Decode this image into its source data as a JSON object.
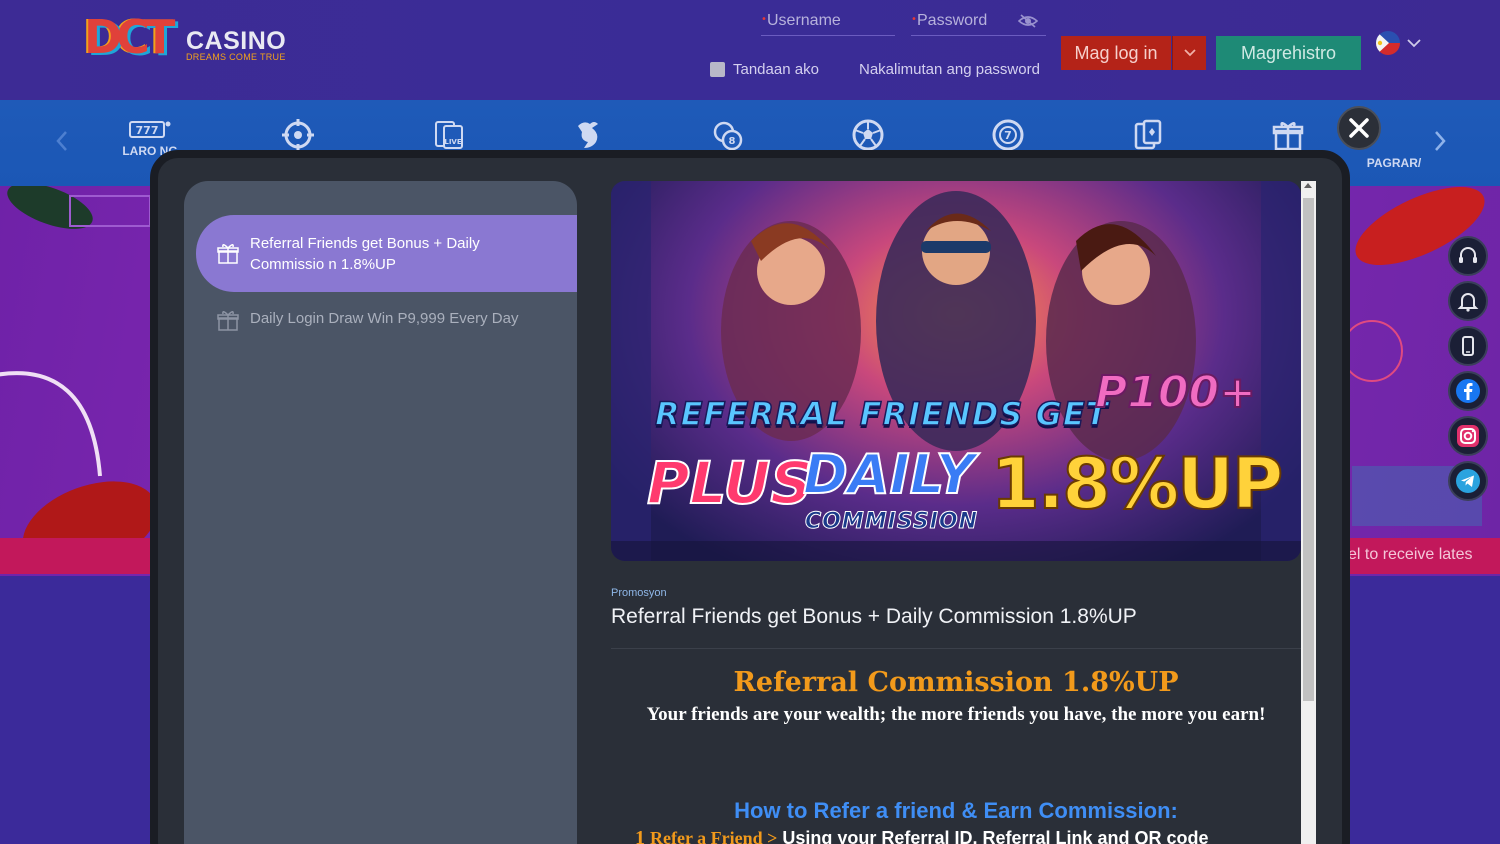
{
  "header": {
    "logo_mark": "DCT",
    "logo_name": "CASINO",
    "logo_tagline": "DREAMS COME TRUE",
    "username_placeholder": "Username",
    "password_placeholder": "Password",
    "remember_label": "Tandaan ako",
    "forgot_label": "Nakalimutan ang password",
    "login_label": "Mag log in",
    "register_label": "Magrehistro"
  },
  "nav": {
    "items": [
      {
        "icon": "slot-777-icon",
        "label": "LARO NG"
      },
      {
        "icon": "fishing-target-icon",
        "label": ""
      },
      {
        "icon": "live-cards-icon",
        "label": ""
      },
      {
        "icon": "cockfight-icon",
        "label": ""
      },
      {
        "icon": "lottery-balls-icon",
        "label": ""
      },
      {
        "icon": "soccer-ball-icon",
        "label": ""
      },
      {
        "icon": "number-seven-ball-icon",
        "label": ""
      },
      {
        "icon": "card-table-icon",
        "label": ""
      },
      {
        "icon": "gift-icon",
        "label": ""
      },
      {
        "icon": "reward-icon",
        "label": "PAGRAR/"
      }
    ]
  },
  "background": {
    "ticker_text": "el to receive lates"
  },
  "modal": {
    "promo_list": [
      {
        "label": "Referral Friends get Bonus + Daily Commissio n 1.8%UP",
        "active": true
      },
      {
        "label": "Daily Login Draw Win P9,999 Every Day",
        "active": false
      }
    ],
    "hero": {
      "line1": "REFERRAL FRIENDS GET",
      "line1b": "P100+",
      "line2a": "PLUS",
      "line2b": "DAILY",
      "line2c": "COMMISSION",
      "line2d": "1.8%UP"
    },
    "category": "Promosyon",
    "title": "Referral Friends get Bonus + Daily Commission 1.8%UP",
    "heading": "Referral Commission 1.8%UP",
    "subheading": "Your friends are your wealth; the more friends you have, the more you earn!",
    "how_heading": "How to Refer a friend & Earn Commission:",
    "step1_num": "1",
    "step1_lead": "Refer a Friend >",
    "step1_text": " Using your Referral ID, Referral Link and QR code"
  },
  "colors": {
    "header_bg": "#3a2c96",
    "nav_bg": "#1f5ab8",
    "login_red": "#b42318",
    "register_green": "#1e8a76",
    "accent_orange": "#f29a1b",
    "accent_blue": "#3f8ef5",
    "active_promo": "#8a78d2"
  }
}
